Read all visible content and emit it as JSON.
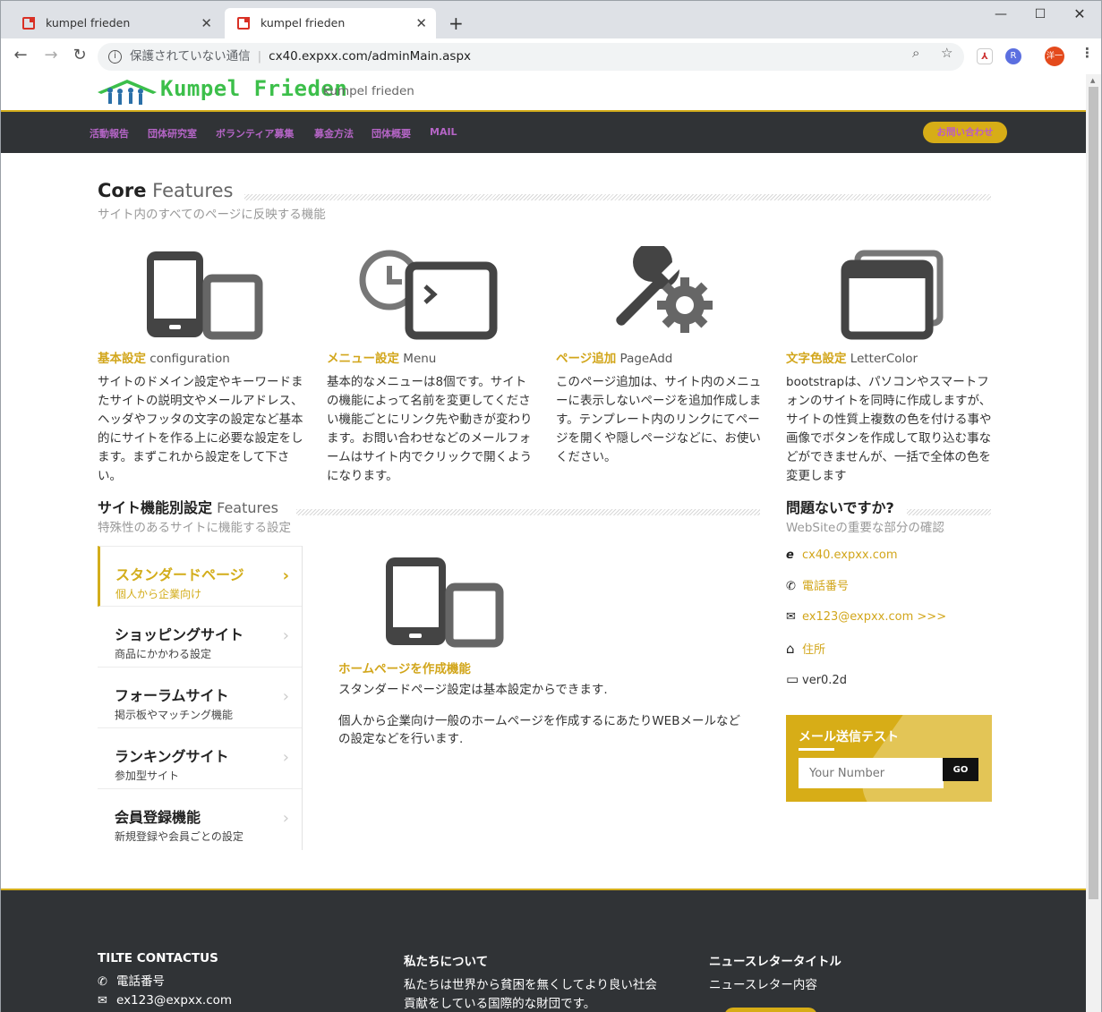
{
  "browser": {
    "tabs": [
      {
        "title": "kumpel frieden",
        "active": false
      },
      {
        "title": "kumpel frieden",
        "active": true
      }
    ],
    "security_label": "保護されていない通信",
    "url": "cx40.expxx.com/adminMain.aspx",
    "ext_profile": "洋一",
    "ext_r": "R"
  },
  "header": {
    "brand": "Kumpel Frieden",
    "subtitle": "kumpel frieden",
    "nav": [
      "活動報告",
      "団体研究室",
      "ボランティア募集",
      "募金方法",
      "団体概要",
      "MAIL"
    ],
    "contact_label": "お問い合わせ"
  },
  "core": {
    "title_bold": "Core",
    "title_rest": "Features",
    "subtitle": "サイト内のすべてのページに反映する機能",
    "features": [
      {
        "title": "基本設定",
        "en": "configuration",
        "icon": "devices-icon",
        "desc": "サイトのドメイン設定やキーワードまたサイトの説明文やメールアドレス、ヘッダやフッタの文字の設定など基本的にサイトを作る上に必要な設定をします。まずこれから設定をして下さい。"
      },
      {
        "title": "メニュー設定",
        "en": "Menu",
        "icon": "clock-window-icon",
        "desc": "基本的なメニューは8個です。サイトの機能によって名前を変更してください機能ごとにリンク先や動きが変わります。お問い合わせなどのメールフォームはサイト内でクリックで開くようになります。"
      },
      {
        "title": "ページ追加",
        "en": "PageAdd",
        "icon": "wrench-gear-icon",
        "desc": "このページ追加は、サイト内のメニューに表示しないページを追加作成します。テンプレート内のリンクにてページを開くや隠しページなどに、お使いください。"
      },
      {
        "title": "文字色設定",
        "en": "LetterColor",
        "icon": "windows-icon",
        "desc": "bootstrapは、パソコンやスマートフォンのサイトを同時に作成しますが、サイトの性質上複数の色を付ける事や画像でボタンを作成して取り込む事などができませんが、一括で全体の色を変更します"
      }
    ]
  },
  "site_features": {
    "title_bold": "サイト機能別設定",
    "title_rest": "Features",
    "subtitle": "特殊性のあるサイトに機能する設定",
    "menu": [
      {
        "title": "スタンダードページ",
        "sub": "個人から企業向け",
        "active": true
      },
      {
        "title": "ショッピングサイト",
        "sub": "商品にかかわる設定",
        "active": false
      },
      {
        "title": "フォーラムサイト",
        "sub": "掲示板やマッチング機能",
        "active": false
      },
      {
        "title": "ランキングサイト",
        "sub": "参加型サイト",
        "active": false
      },
      {
        "title": "会員登録機能",
        "sub": "新規登録や会員ごとの設定",
        "active": false
      }
    ],
    "pane": {
      "title": "ホームページを作成機能",
      "line1": "スタンダードページ設定は基本設定からできます.",
      "line2": "個人から企業向け一般のホームページを作成するにあたりWEBメールなどの設定などを行います."
    }
  },
  "check": {
    "title": "問題ないですか?",
    "subtitle": "WebSiteの重要な部分の確認",
    "items": [
      {
        "icon": "ie-icon",
        "glyph": "e",
        "text": "cx40.expxx.com"
      },
      {
        "icon": "phone-icon",
        "glyph": "✆",
        "text": "電話番号"
      },
      {
        "icon": "mail-icon",
        "glyph": "✉",
        "text": "ex123@expxx.com >>>"
      },
      {
        "icon": "home-icon",
        "glyph": "⌂",
        "text": "住所"
      },
      {
        "icon": "monitor-icon",
        "glyph": "▭",
        "text": "ver0.2d"
      }
    ]
  },
  "mail_test": {
    "title": "メール送信テスト",
    "placeholder": "Your Number",
    "button": "GO"
  },
  "footer": {
    "col1": {
      "title": "TILTE CONTACTUS",
      "phone": "電話番号",
      "email": "ex123@expxx.com"
    },
    "col2": {
      "title": "私たちについて",
      "text1": "私たちは世界から貧困を無くしてより良い社会",
      "text2": "貢献をしている国際的な財団です。"
    },
    "col3": {
      "title": "ニュースレタータイトル",
      "text": "ニュースレター内容"
    }
  },
  "colors": {
    "accent": "#d3ad1b",
    "nav_bg": "#303336",
    "nav_link": "#b565c6",
    "brand_green": "#3cbf4a"
  }
}
